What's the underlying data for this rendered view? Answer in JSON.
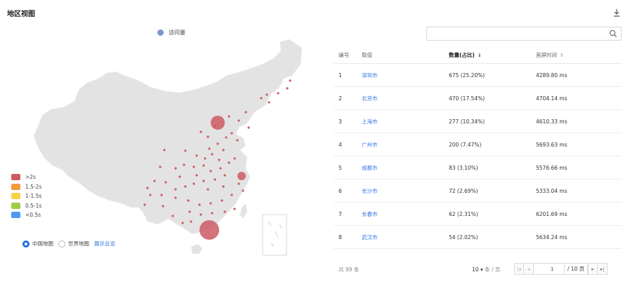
{
  "header": {
    "title": "地区视图"
  },
  "map": {
    "legend_label": "访问量",
    "scale": [
      {
        "label": ">2s",
        "color": "#cc5a64"
      },
      {
        "label": "1.5-2s",
        "color": "#f39a3c"
      },
      {
        "label": "1-1.5s",
        "color": "#f5d24a"
      },
      {
        "label": "0.5-1s",
        "color": "#9fcd45"
      },
      {
        "label": "<0.5s",
        "color": "#4e9af0"
      }
    ],
    "switch": {
      "china": "中国地图",
      "world": "世界地图",
      "overview": "展示总览",
      "selected": "china"
    }
  },
  "search": {
    "value": "",
    "placeholder": ""
  },
  "table": {
    "columns": {
      "index": "编号",
      "region": "取值",
      "count": "数量(占比)",
      "time": "首屏时间"
    },
    "rows": [
      {
        "index": "1",
        "region": "深圳市",
        "count": "675 (25.20%)",
        "time": "4289.80 ms"
      },
      {
        "index": "2",
        "region": "北京市",
        "count": "470 (17.54%)",
        "time": "4704.14 ms"
      },
      {
        "index": "3",
        "region": "上海市",
        "count": "277 (10.34%)",
        "time": "4610.33 ms"
      },
      {
        "index": "4",
        "region": "广州市",
        "count": "200 (7.47%)",
        "time": "5693.63 ms"
      },
      {
        "index": "5",
        "region": "成都市",
        "count": "83 (3.10%)",
        "time": "5576.66 ms"
      },
      {
        "index": "6",
        "region": "长沙市",
        "count": "72 (2.69%)",
        "time": "5333.04 ms"
      },
      {
        "index": "7",
        "region": "长春市",
        "count": "62 (2.31%)",
        "time": "6201.69 ms"
      },
      {
        "index": "8",
        "region": "武汉市",
        "count": "54 (2.02%)",
        "time": "5634.24 ms"
      }
    ]
  },
  "pagination": {
    "total": "共 99 条",
    "per_page": "10",
    "per_page_unit": "条 / 页",
    "page": "1",
    "pages": "/ 10 页"
  },
  "colors": {
    "accent": "#2f74e0",
    "bubble": "#cc5a64",
    "land": "#e3e3e3"
  }
}
